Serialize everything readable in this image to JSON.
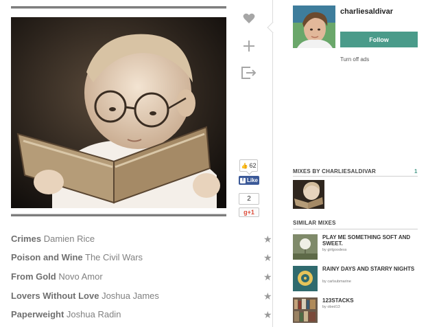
{
  "mix": {
    "cover_alt": "Cover image: baby wearing round glasses reading a book (sepia)"
  },
  "actions": {
    "like_icon": "heart-icon",
    "add_icon": "plus-icon",
    "share_icon": "share-exit-icon"
  },
  "social": {
    "facebook_count": "62",
    "facebook_like_label": "Like",
    "facebook_f": "f",
    "gplus_count": "2",
    "gplus_label": "g+1"
  },
  "user": {
    "username": "charliesaldivar",
    "follow_label": "Follow",
    "turn_off_ads": "Turn off ads"
  },
  "mixes_by": {
    "heading": "MIXES BY CHARLIESALDIVAR",
    "count": "1"
  },
  "similar": {
    "heading": "SIMILAR MIXES",
    "items": [
      {
        "title": "PLAY ME SOMETHING SOFT AND SWEET.",
        "by": "by girlgoodess"
      },
      {
        "title": "RAINY DAYS AND STARRY NIGHTS",
        "by": "by carlsubmarine"
      },
      {
        "title": "123STACKS",
        "by": "by obed13"
      }
    ]
  },
  "tracks": [
    {
      "title": "Crimes",
      "artist": "Damien Rice"
    },
    {
      "title": "Poison and Wine",
      "artist": "The Civil Wars"
    },
    {
      "title": "From Gold",
      "artist": "Novo Amor"
    },
    {
      "title": "Lovers Without Love",
      "artist": "Joshua James"
    },
    {
      "title": "Paperweight",
      "artist": "Joshua Radin"
    }
  ],
  "colors": {
    "accent": "#4a9b8a",
    "facebook": "#3b5998",
    "gplus": "#dd4b39"
  }
}
